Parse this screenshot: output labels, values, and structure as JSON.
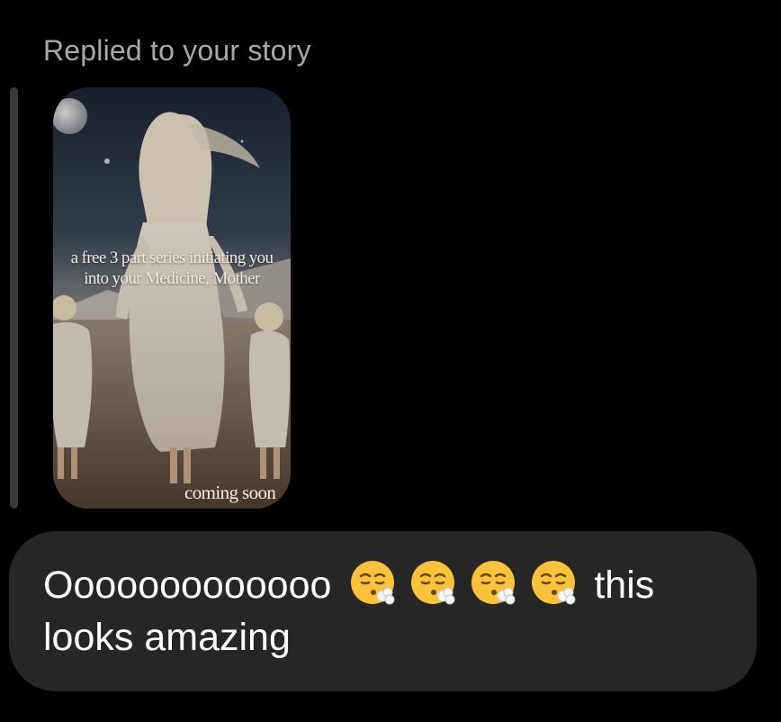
{
  "reply": {
    "label": "Replied to your story"
  },
  "story": {
    "caption_line1": "a free 3 part series initiating you",
    "caption_line2": "into your Medicine, Mother",
    "footer_text": "coming soon"
  },
  "message": {
    "text_before_emoji": "Ooooooooooooo",
    "emoji_name": "face-exhaling-emoji",
    "emoji_count": 4,
    "text_after_emoji": "this",
    "text_line2": "looks amazing"
  },
  "colors": {
    "background": "#000000",
    "bubble": "#262626",
    "reply_bar": "#3a3a3a",
    "label_text": "#a8a8a8",
    "message_text": "#ffffff"
  }
}
